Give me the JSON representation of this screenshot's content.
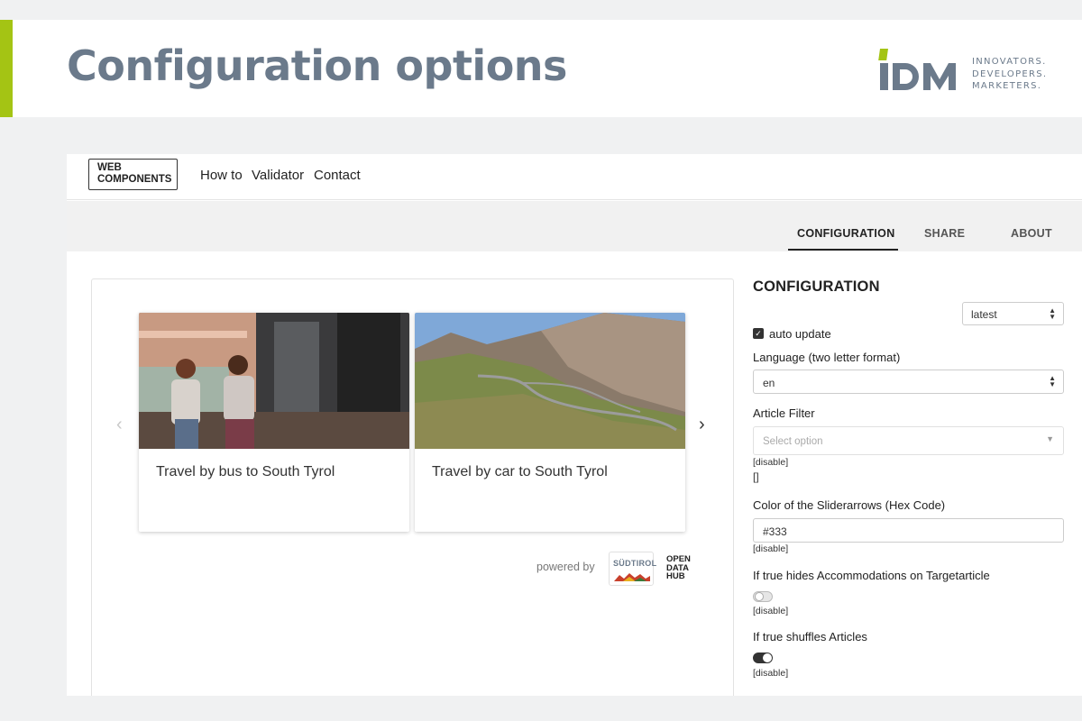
{
  "slide": {
    "title": "Configuration options",
    "accent_color": "#a4c414",
    "logo": {
      "text": "iDM",
      "tagline_1": "INNOVATORS.",
      "tagline_2": "DEVELOPERS.",
      "tagline_3": "MARKETERS."
    }
  },
  "nav": {
    "brand_line1": "WEB",
    "brand_line2": "COMPONENTS",
    "links": [
      "How to",
      "Validator",
      "Contact"
    ]
  },
  "tabs": [
    {
      "label": "CONFIGURATION",
      "active": true
    },
    {
      "label": "SHARE",
      "active": false
    },
    {
      "label": "ABOUT",
      "active": false
    }
  ],
  "preview": {
    "cards": [
      {
        "title": "Travel by bus to South Tyrol",
        "image": "two-women-at-bus-station-photo"
      },
      {
        "title": "Travel by car to South Tyrol",
        "image": "mountain-pass-road-photo"
      }
    ],
    "prev_arrow": "‹",
    "next_arrow": "›",
    "powered_by": "powered by",
    "partner1": "SÜDTIROL",
    "partner2_line1": "OPEN",
    "partner2_line2": "DATA",
    "partner2_line3": "HUB"
  },
  "config": {
    "heading": "CONFIGURATION",
    "version_select": "latest",
    "auto_update_label": "auto update",
    "auto_update_checked": true,
    "language_label": "Language (two letter format)",
    "language_value": "en",
    "article_filter_label": "Article Filter",
    "article_filter_placeholder": "Select option",
    "disable_text": "[disable]",
    "article_filter_value": "[]",
    "slider_color_label": "Color of the Sliderarrows (Hex Code)",
    "slider_color_value": "#333",
    "hide_accommodations_label": "If true hides Accommodations on Targetarticle",
    "hide_accommodations_on": false,
    "shuffle_label": "If true shuffles Articles",
    "shuffle_on": true
  }
}
